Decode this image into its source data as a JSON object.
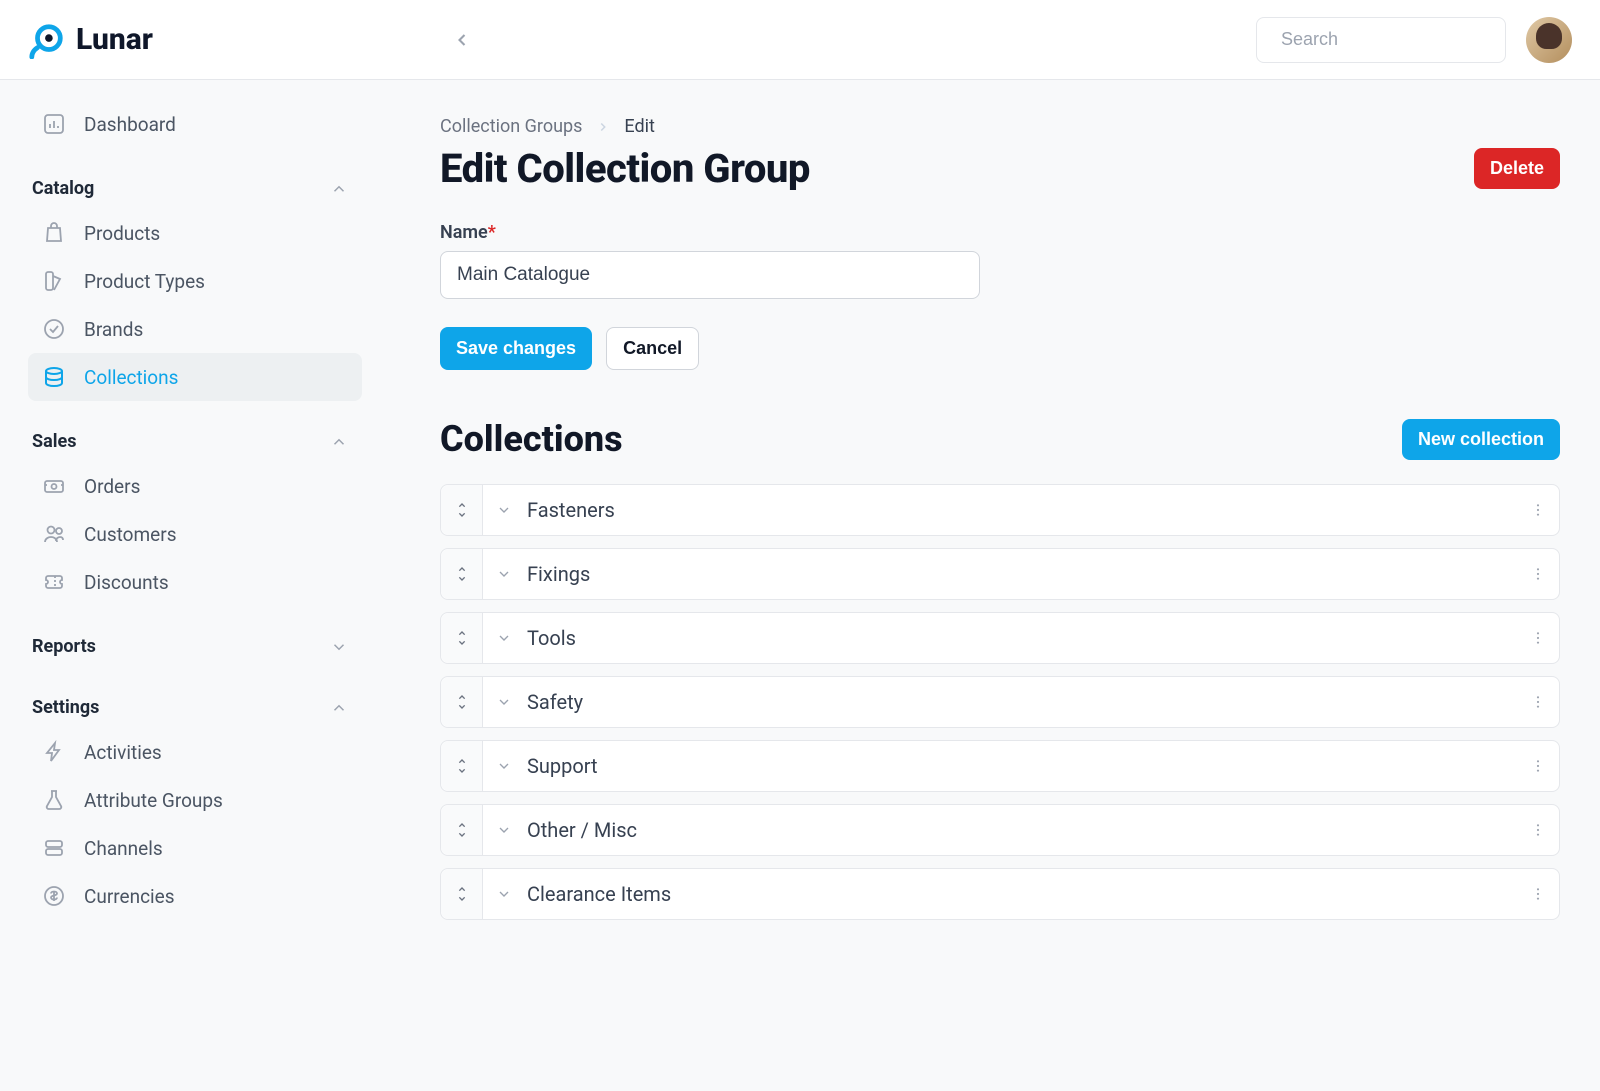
{
  "app": {
    "name": "Lunar"
  },
  "search": {
    "placeholder": "Search"
  },
  "sidebar": {
    "dashboard": "Dashboard",
    "catalog_header": "Catalog",
    "catalog": [
      {
        "label": "Products"
      },
      {
        "label": "Product Types"
      },
      {
        "label": "Brands"
      },
      {
        "label": "Collections"
      }
    ],
    "sales_header": "Sales",
    "sales": [
      {
        "label": "Orders"
      },
      {
        "label": "Customers"
      },
      {
        "label": "Discounts"
      }
    ],
    "reports_header": "Reports",
    "settings_header": "Settings",
    "settings": [
      {
        "label": "Activities"
      },
      {
        "label": "Attribute Groups"
      },
      {
        "label": "Channels"
      },
      {
        "label": "Currencies"
      }
    ]
  },
  "breadcrumb": {
    "root": "Collection Groups",
    "current": "Edit"
  },
  "page": {
    "title": "Edit Collection Group",
    "delete": "Delete",
    "name_label": "Name",
    "name_value": "Main Catalogue",
    "save": "Save changes",
    "cancel": "Cancel",
    "collections_title": "Collections",
    "new_collection": "New collection"
  },
  "collections": [
    {
      "name": "Fasteners"
    },
    {
      "name": "Fixings"
    },
    {
      "name": "Tools"
    },
    {
      "name": "Safety"
    },
    {
      "name": "Support"
    },
    {
      "name": "Other / Misc"
    },
    {
      "name": "Clearance Items"
    }
  ]
}
